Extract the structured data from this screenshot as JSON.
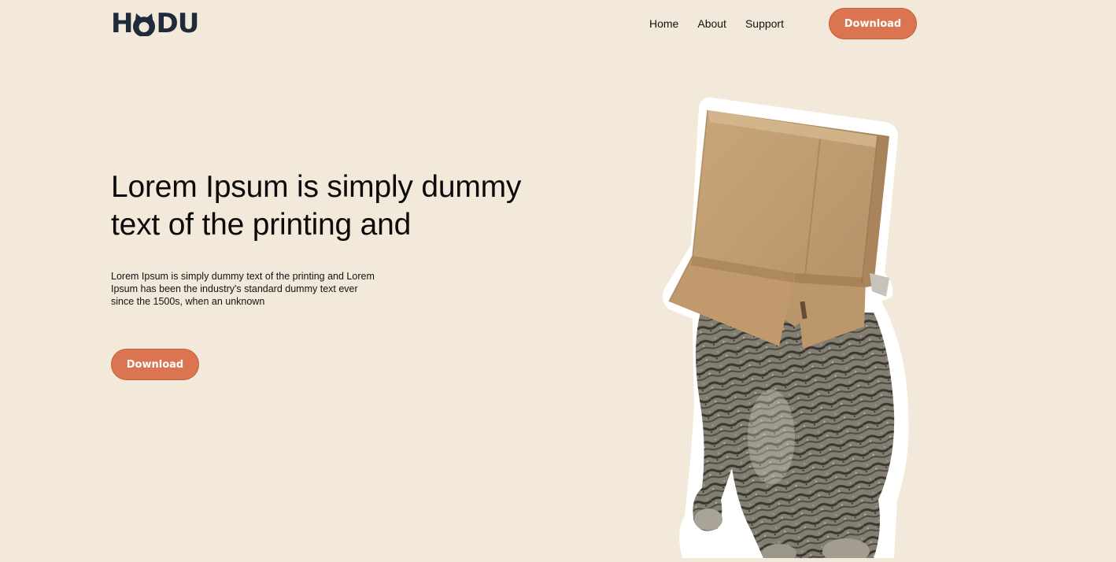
{
  "brand": {
    "logo_text_before": "H",
    "logo_text_after": "DU",
    "logo_color": "#1F2A3A"
  },
  "nav": {
    "items": [
      {
        "label": "Home"
      },
      {
        "label": "About"
      },
      {
        "label": "Support"
      }
    ]
  },
  "header": {
    "cta_label": "Download"
  },
  "hero": {
    "title": "Lorem Ipsum is simply dummy text of the printing and",
    "description": "Lorem Ipsum is simply dummy text of the printing and Lorem Ipsum has been the industry's standard dummy text ever since the 1500s, when an unknown",
    "cta_label": "Download"
  },
  "theme": {
    "background": "#F3E9DA",
    "accent": "#DB7551",
    "text": "#0B0B0B"
  },
  "illustration": {
    "icon": "cat-with-box-image"
  }
}
